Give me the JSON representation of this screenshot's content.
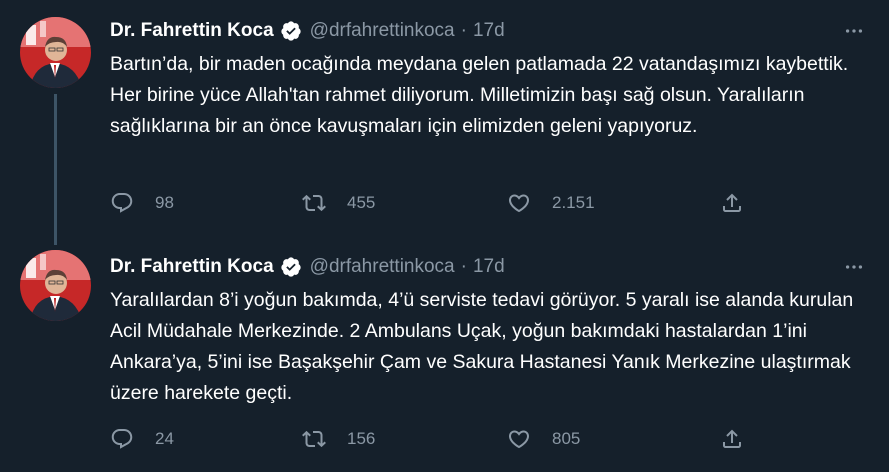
{
  "tweets": [
    {
      "author": {
        "name": "Dr. Fahrettin Koca",
        "handle": "@drfahrettinkoca",
        "verified": true
      },
      "separator": "·",
      "time": "17d",
      "text": "Bartın’da, bir maden ocağında meydana gelen patlamada 22 vatandaşımızı kaybettik. Her birine yüce Allah'tan rahmet diliyorum. Milletimizin başı sağ olsun. Yaralıların sağlıklarına bir an önce kavuşmaları için elimizden geleni yapıyoruz.",
      "replies": "98",
      "retweets": "455",
      "likes": "2.151"
    },
    {
      "author": {
        "name": "Dr. Fahrettin Koca",
        "handle": "@drfahrettinkoca",
        "verified": true
      },
      "separator": "·",
      "time": "17d",
      "text": "Yaralılardan 8’i yoğun bakımda, 4’ü serviste tedavi görüyor. 5 yaralı ise alanda kurulan Acil Müdahale Merkezinde. 2 Ambulans Uçak, yoğun bakımdaki hastalardan 1’ini Ankara’ya, 5’ini ise Başakşehir Çam ve Sakura Hastanesi Yanık Merkezine ulaştırmak üzere harekete geçti.",
      "replies": "24",
      "retweets": "156",
      "likes": "805"
    }
  ],
  "colors": {
    "background": "#15202b",
    "text": "#ffffff",
    "secondary": "#8b98a5",
    "verified_badge": "#ffffff",
    "thread_line": "#3d5466"
  },
  "icons": {
    "verified": "verified-badge-icon",
    "more": "more-dots-icon",
    "reply": "reply-bubble-icon",
    "retweet": "retweet-icon",
    "like": "heart-icon",
    "share": "share-icon"
  }
}
